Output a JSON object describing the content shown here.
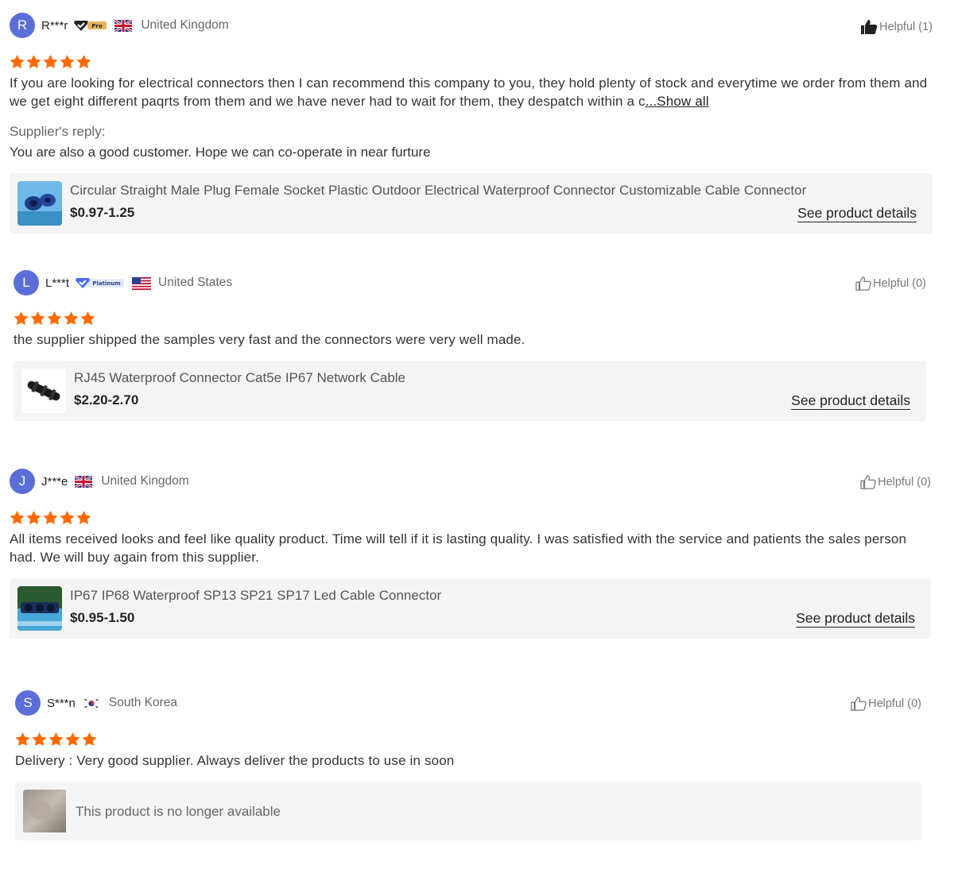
{
  "reviews": [
    {
      "initial": "R",
      "name": "R***r",
      "badge": "Pro",
      "country": "United Kingdom",
      "helpful": "Helpful (1)",
      "text": "If you are looking for electrical connectors then I can recommend this company to you, they hold plenty of stock and everytime we order from them and we get eight different paqrts from them and we have never had to wait for them, they despatch within a c",
      "show_all": "...Show all",
      "reply_label": "Supplier's reply:",
      "reply_text": "You are also a good customer. Hope we can co-operate in near furture",
      "product_title": "Circular Straight Male Plug Female Socket Plastic Outdoor Electrical Waterproof Connector Customizable Cable Connector",
      "product_price": "$0.97-1.25",
      "details_link": "See product details"
    },
    {
      "initial": "L",
      "name": "L***t",
      "badge": "Platinum",
      "country": "United States",
      "helpful": "Helpful (0)",
      "text": "the supplier shipped the samples very fast and the connectors were very well made.",
      "product_title": "RJ45 Waterproof Connector Cat5e IP67 Network Cable",
      "product_price": "$2.20-2.70",
      "details_link": "See product details"
    },
    {
      "initial": "J",
      "name": "J***e",
      "country": "United Kingdom",
      "helpful": "Helpful (0)",
      "text": "All items received looks and feel like quality product. Time will tell if it is lasting quality. I was satisfied with the service and patients the sales person had. We will buy again from this supplier.",
      "product_title": "IP67 IP68 Waterproof SP13 SP21 SP17 Led Cable Connector",
      "product_price": "$0.95-1.50",
      "details_link": "See product details"
    },
    {
      "initial": "S",
      "name": "S***n",
      "country": "South Korea",
      "helpful": "Helpful (0)",
      "text": "Delivery : Very good supplier. Always deliver the products to use in soon",
      "unavailable": "This product is no longer available"
    }
  ],
  "rating": 5,
  "colors": {
    "star": "#ff6a00",
    "avatar": "#5b6ed8",
    "card": "#f4f4f4",
    "badge_blue": "#4a6cf7"
  },
  "icons": [
    "thumbs-up-icon",
    "star-icon",
    "verified-badge-icon",
    "flag-uk-icon",
    "flag-us-icon",
    "flag-kr-icon"
  ]
}
